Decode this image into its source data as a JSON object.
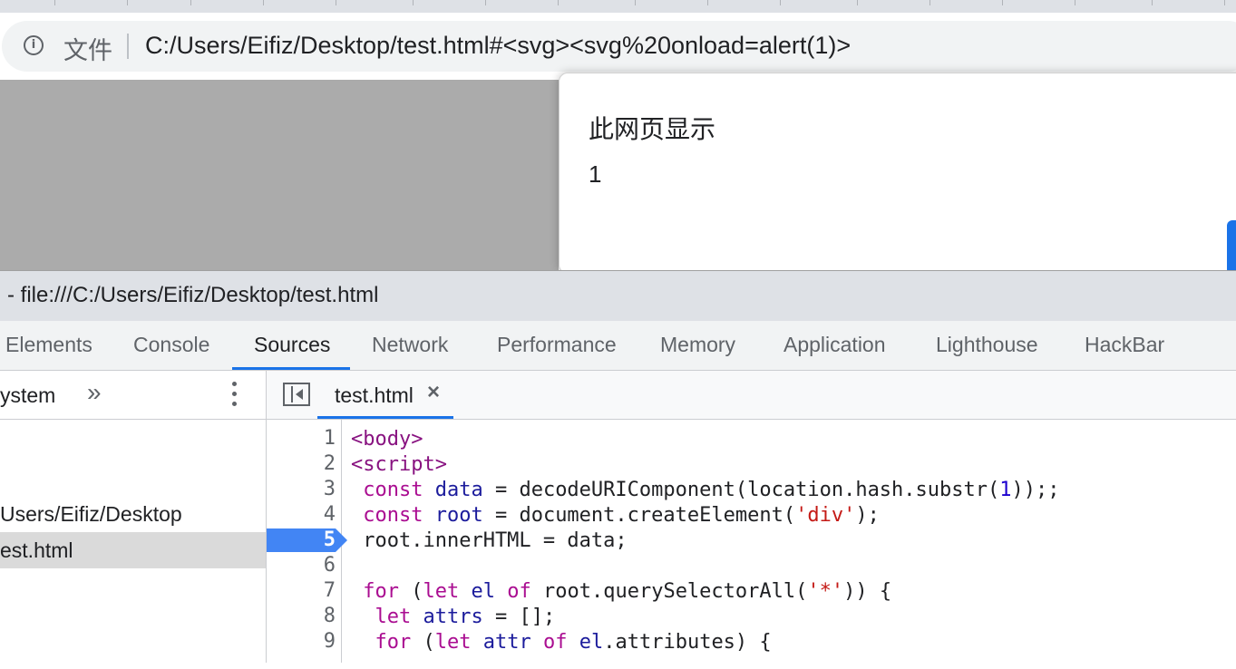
{
  "omnibox": {
    "label": "文件",
    "url": "C:/Users/Eifiz/Desktop/test.html#<svg><svg%20onload=alert(1)>"
  },
  "dialog": {
    "title": "此网页显示",
    "message": "1"
  },
  "devtools": {
    "window_title": "- file:///C:/Users/Eifiz/Desktop/test.html",
    "tabs": [
      "Elements",
      "Console",
      "Sources",
      "Network",
      "Performance",
      "Memory",
      "Application",
      "Lighthouse",
      "HackBar"
    ],
    "active_tab": "Sources",
    "navigator": {
      "filesystem_label": "ystem",
      "more_label": "»",
      "folder": "Users/Eifiz/Desktop",
      "file": "est.html"
    },
    "editor": {
      "open_file": "test.html",
      "close_glyph": "×",
      "breakpoint_line": "5",
      "line_numbers": [
        "1",
        "2",
        "3",
        "4",
        "5",
        "6",
        "7",
        "8",
        "9"
      ]
    }
  },
  "colors": {
    "accent": "#1a73e8",
    "tag": "#881280",
    "keyword": "#aa0d91",
    "string": "#c41a16"
  }
}
